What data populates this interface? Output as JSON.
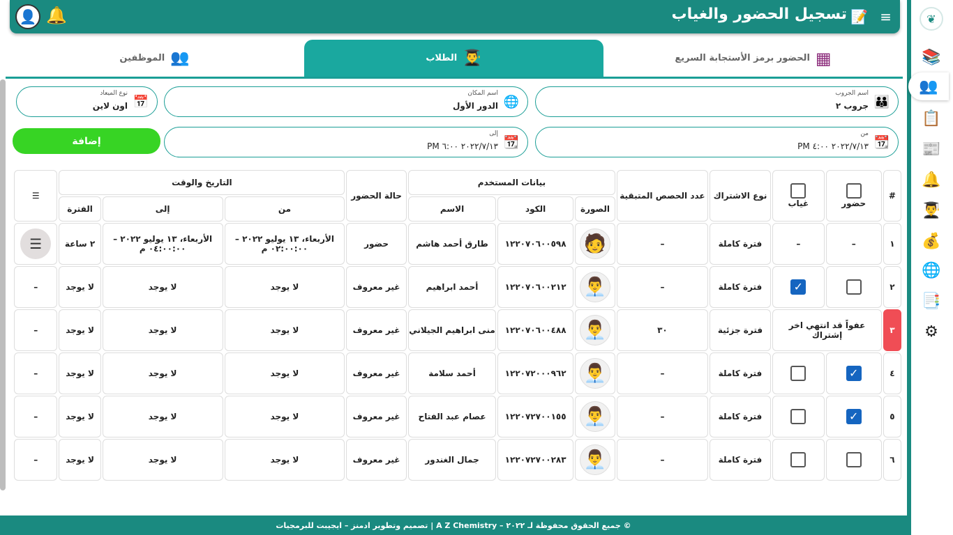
{
  "header": {
    "title": "تسجيل الحضور والغياب"
  },
  "tabs": [
    {
      "label": "الحضور برمز الأستجابة السريع"
    },
    {
      "label": "الطلاب"
    },
    {
      "label": "الموظفين"
    }
  ],
  "fields": {
    "group": {
      "label": "اسم الجروب",
      "value": "جروب ٢"
    },
    "place": {
      "label": "اسم المكان",
      "value": "الدور الأول"
    },
    "appointment_type": {
      "label": "نوع الميعاد",
      "value": "اون لاين"
    },
    "from": {
      "label": "من",
      "value": "٢٠٢٢/٧/١٣ ٤:٠٠ PM"
    },
    "to": {
      "label": "إلى",
      "value": "٢٠٢٢/٧/١٣ ٦:٠٠ PM"
    }
  },
  "add_button": "إضافة",
  "table": {
    "headers": {
      "index": "#",
      "attend": "حضور",
      "absent": "غياب",
      "subscription_type": "نوع الاشتراك",
      "remaining_sessions": "عدد الحصص المتبقية",
      "user_data": "بيانات المستخدم",
      "photo": "الصورة",
      "code": "الكود",
      "name": "الاسم",
      "attendance_status": "حالة الحضور",
      "datetime": "التاريخ والوقت",
      "from": "من",
      "to": "إلى",
      "period": "الفترة"
    },
    "rows": [
      {
        "idx": "١",
        "attend": "–",
        "absent": "–",
        "sub": "فترة كاملة",
        "remaining": "–",
        "code": "١٢٢٠٧٠٦٠٠٥٩٨",
        "name": "طارق أحمد هاشم",
        "status": "حضور",
        "from": "الأربعاء، ١٣ يوليو ٢٠٢٢ – ٠٢:٠٠:٠٠ م",
        "to": "الأربعاء، ١٣ يوليو ٢٠٢٢ – ٠٤:٠٠:٠٠ م",
        "period": "٢ ساعة",
        "action": "settings"
      },
      {
        "idx": "٢",
        "attend": "unchecked",
        "absent": "checked",
        "sub": "فترة كاملة",
        "remaining": "–",
        "code": "١٢٢٠٧٠٦٠٠٢١٢",
        "name": "أحمد ابراهيم",
        "status": "غير معروف",
        "from": "لا يوجد",
        "to": "لا يوجد",
        "period": "لا يوجد",
        "action": "–"
      },
      {
        "idx": "٣",
        "attend": "عفواً قد انتهي اخر إشتراك",
        "absent": "",
        "sub": "فترة جزئية",
        "remaining": "٣٠",
        "code": "١٢٢٠٧٠٦٠٠٤٨٨",
        "name": "منى ابراهيم الجيلاني",
        "status": "غير معروف",
        "from": "لا يوجد",
        "to": "لا يوجد",
        "period": "لا يوجد",
        "action": "–"
      },
      {
        "idx": "٤",
        "attend": "checked",
        "absent": "unchecked",
        "sub": "فترة كاملة",
        "remaining": "–",
        "code": "١٢٢٠٧٢٠٠٠٩٦٢",
        "name": "أحمد سلامة",
        "status": "غير معروف",
        "from": "لا يوجد",
        "to": "لا يوجد",
        "period": "لا يوجد",
        "action": "–"
      },
      {
        "idx": "٥",
        "attend": "checked",
        "absent": "unchecked",
        "sub": "فترة كاملة",
        "remaining": "–",
        "code": "١٢٢٠٧٢٧٠٠١٥٥",
        "name": "عصام عبد الفتاح",
        "status": "غير معروف",
        "from": "لا يوجد",
        "to": "لا يوجد",
        "period": "لا يوجد",
        "action": "–"
      },
      {
        "idx": "٦",
        "attend": "unchecked",
        "absent": "unchecked",
        "sub": "فترة كاملة",
        "remaining": "–",
        "code": "١٢٢٠٧٢٧٠٠٢٨٣",
        "name": "جمال الغندور",
        "status": "غير معروف",
        "from": "لا يوجد",
        "to": "لا يوجد",
        "period": "لا يوجد",
        "action": "–"
      }
    ]
  },
  "footer": "© جميع الحقوق محفوظة لـ ٢٠٢٢ – A Z Chemistry | تصميم وتطوير ادمنز – ايجيبت للبرمجيات",
  "colors": {
    "primary": "#1a8a80",
    "tab_active": "#1aa89f",
    "add": "#37d424",
    "check": "#1565c0",
    "alert": "#f04d55"
  }
}
